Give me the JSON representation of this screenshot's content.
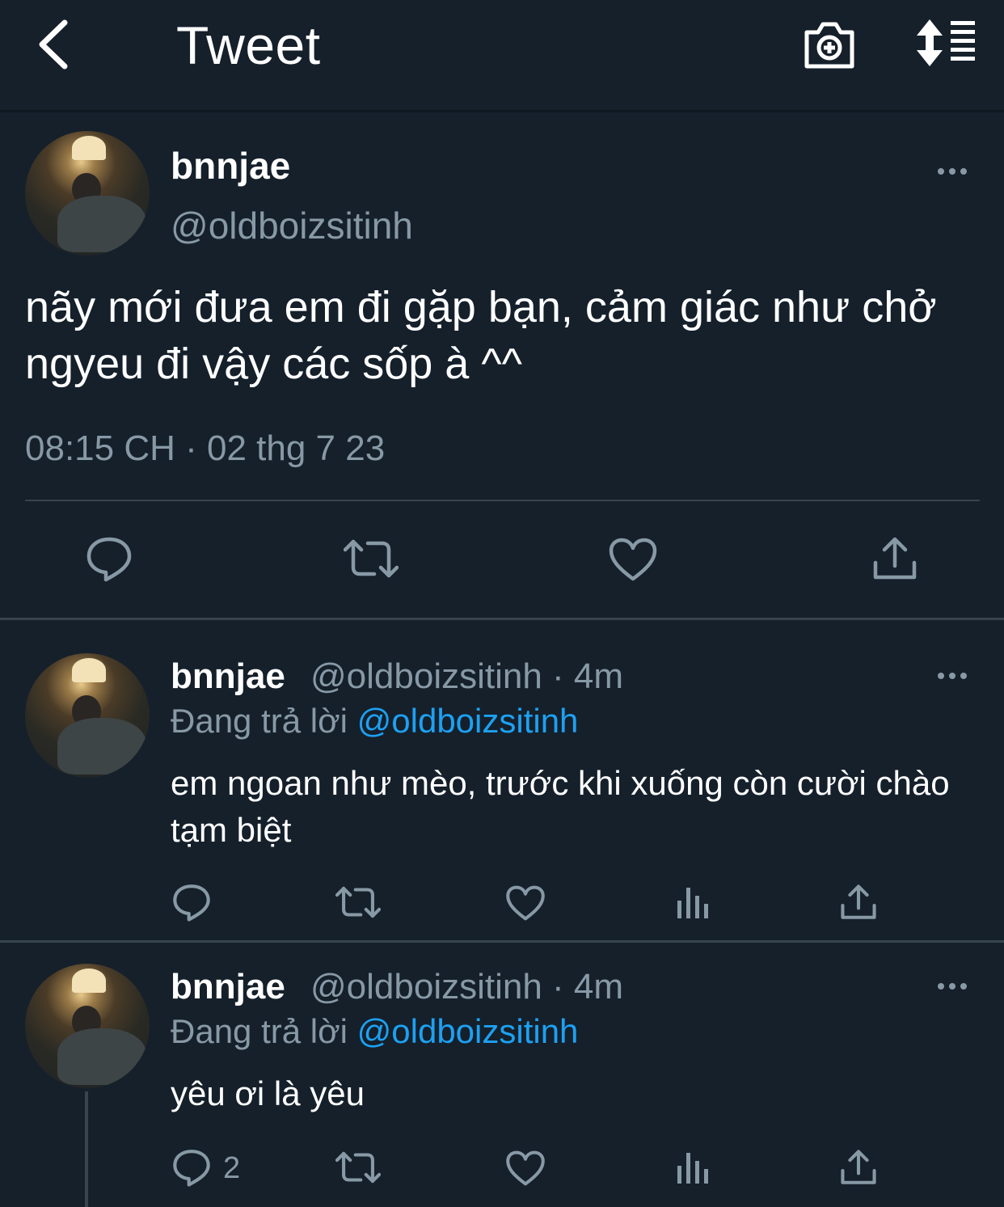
{
  "header": {
    "title": "Tweet"
  },
  "main_tweet": {
    "name": "bnnjae",
    "handle": "@oldboizsitinh",
    "text": "nãy mới đưa em đi gặp bạn, cảm giác như chở ngyeu đi vậy các sốp à ^^",
    "timestamp": "08:15 CH · 02 thg 7 23",
    "actions": [
      "reply-icon",
      "retweet-icon",
      "heart-icon",
      "share-icon"
    ]
  },
  "replies": [
    {
      "name": "bnnjae",
      "handle_time": "@oldboizsitinh · 4m",
      "replying_prefix": "Đang trả lời ",
      "replying_to": "@oldboizsitinh",
      "text": "em ngoan như mèo, trước khi xuống còn cười chào tạm biệt",
      "reply_count": ""
    },
    {
      "name": "bnnjae",
      "handle_time": "@oldboizsitinh · 4m",
      "replying_prefix": "Đang trả lời ",
      "replying_to": "@oldboizsitinh",
      "text": "yêu ơi là yêu",
      "reply_count": "2"
    }
  ],
  "colors": {
    "background": "#15202b",
    "muted": "#8899a6",
    "accent": "#1da1f2",
    "divider": "#38444d"
  }
}
